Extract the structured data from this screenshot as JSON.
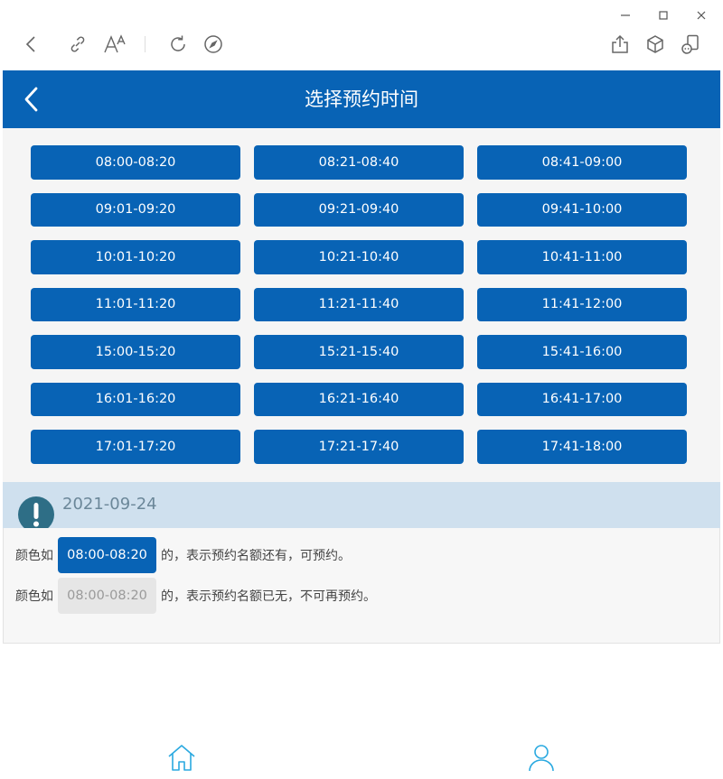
{
  "window": {
    "controls": [
      "minimize-icon",
      "maximize-icon",
      "close-icon"
    ]
  },
  "toolbar": {
    "icons": [
      "back-arrow-icon",
      "link-icon",
      "text-size-icon",
      "reload-icon",
      "compass-icon",
      "share-icon",
      "cube-icon",
      "mini-program-icon"
    ]
  },
  "header": {
    "title": "选择预约时间"
  },
  "slots": [
    "08:00-08:20",
    "08:21-08:40",
    "08:41-09:00",
    "09:01-09:20",
    "09:21-09:40",
    "09:41-10:00",
    "10:01-10:20",
    "10:21-10:40",
    "10:41-11:00",
    "11:01-11:20",
    "11:21-11:40",
    "11:41-12:00",
    "15:00-15:20",
    "15:21-15:40",
    "15:41-16:00",
    "16:01-16:20",
    "16:21-16:40",
    "16:41-17:00",
    "17:01-17:20",
    "17:21-17:40",
    "17:41-18:00"
  ],
  "info": {
    "date": "2021-09-24"
  },
  "legend": {
    "available": {
      "prefix": "颜色如",
      "chip": "08:00-08:20",
      "suffix": "的，表示预约名额还有，可预约。"
    },
    "full": {
      "prefix": "颜色如",
      "chip": "08:00-08:20",
      "suffix": "的，表示预约名额已无，不可再预约。"
    }
  },
  "colors": {
    "primary": "#0863b5",
    "info_bar": "#cfe0ee",
    "disabled_chip": "#e6e6e6",
    "nav_icon": "#2aa9e0"
  },
  "bottom_nav": [
    "home-icon",
    "user-icon"
  ]
}
